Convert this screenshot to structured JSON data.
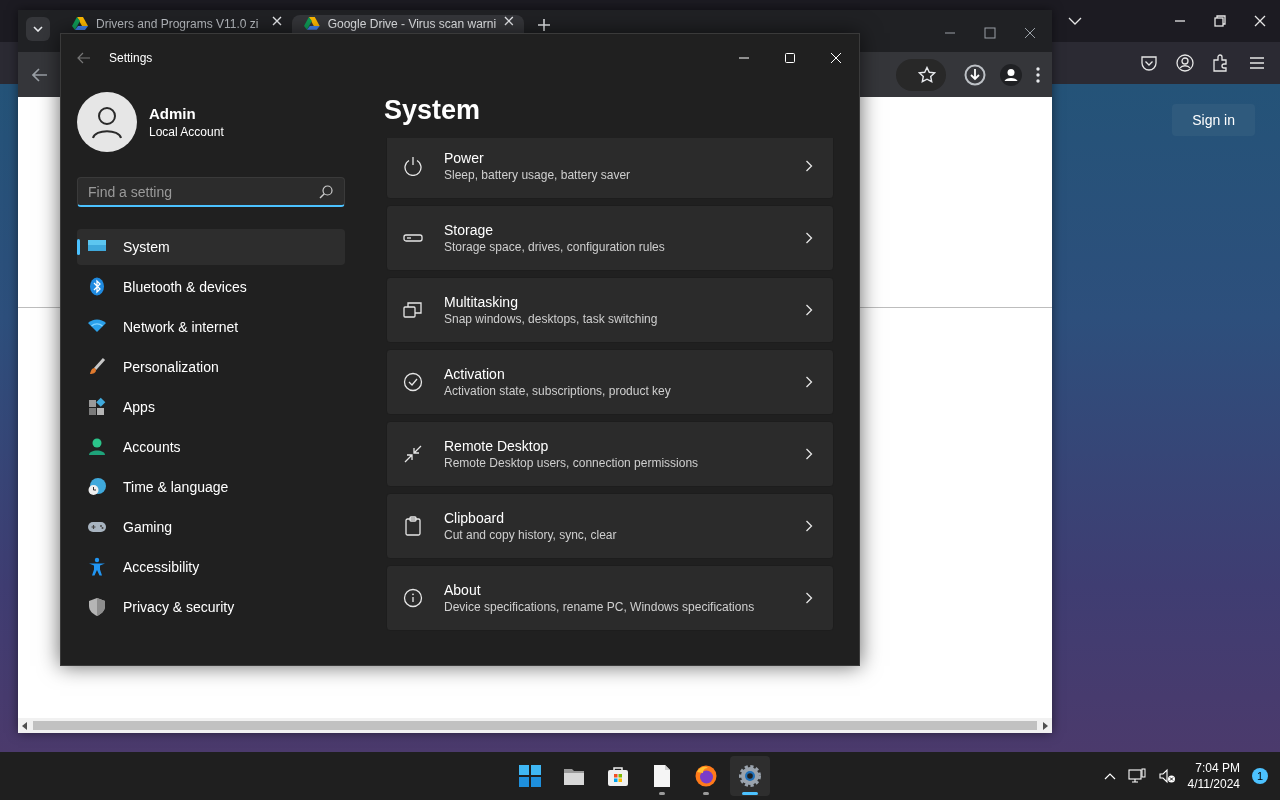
{
  "background_browser": {
    "sign_in_button": "Sign in"
  },
  "browser": {
    "tabs": [
      {
        "title": "Drivers and Programs V11.0 zi",
        "selected": false
      },
      {
        "title": "Google Drive - Virus scan warni",
        "selected": true
      }
    ]
  },
  "settings": {
    "title": "Settings",
    "account": {
      "name": "Admin",
      "type": "Local Account"
    },
    "search": {
      "placeholder": "Find a setting"
    },
    "nav": [
      {
        "label": "System",
        "selected": true
      },
      {
        "label": "Bluetooth & devices",
        "selected": false
      },
      {
        "label": "Network & internet",
        "selected": false
      },
      {
        "label": "Personalization",
        "selected": false
      },
      {
        "label": "Apps",
        "selected": false
      },
      {
        "label": "Accounts",
        "selected": false
      },
      {
        "label": "Time & language",
        "selected": false
      },
      {
        "label": "Gaming",
        "selected": false
      },
      {
        "label": "Accessibility",
        "selected": false
      },
      {
        "label": "Privacy & security",
        "selected": false
      }
    ],
    "page_title": "System",
    "cards": [
      {
        "title": "Power",
        "description": "Sleep, battery usage, battery saver"
      },
      {
        "title": "Storage",
        "description": "Storage space, drives, configuration rules"
      },
      {
        "title": "Multitasking",
        "description": "Snap windows, desktops, task switching"
      },
      {
        "title": "Activation",
        "description": "Activation state, subscriptions, product key"
      },
      {
        "title": "Remote Desktop",
        "description": "Remote Desktop users, connection permissions"
      },
      {
        "title": "Clipboard",
        "description": "Cut and copy history, sync, clear"
      },
      {
        "title": "About",
        "description": "Device specifications, rename PC, Windows specifications"
      }
    ]
  },
  "taskbar": {
    "apps": [
      {
        "running": false,
        "selected": false
      },
      {
        "running": false,
        "selected": false
      },
      {
        "running": false,
        "selected": false
      },
      {
        "running": true,
        "selected": false
      },
      {
        "running": true,
        "selected": false
      },
      {
        "running": true,
        "selected": true
      }
    ],
    "tray": {
      "time": "7:04 PM",
      "date": "4/11/2024",
      "notification_count": "1"
    }
  }
}
